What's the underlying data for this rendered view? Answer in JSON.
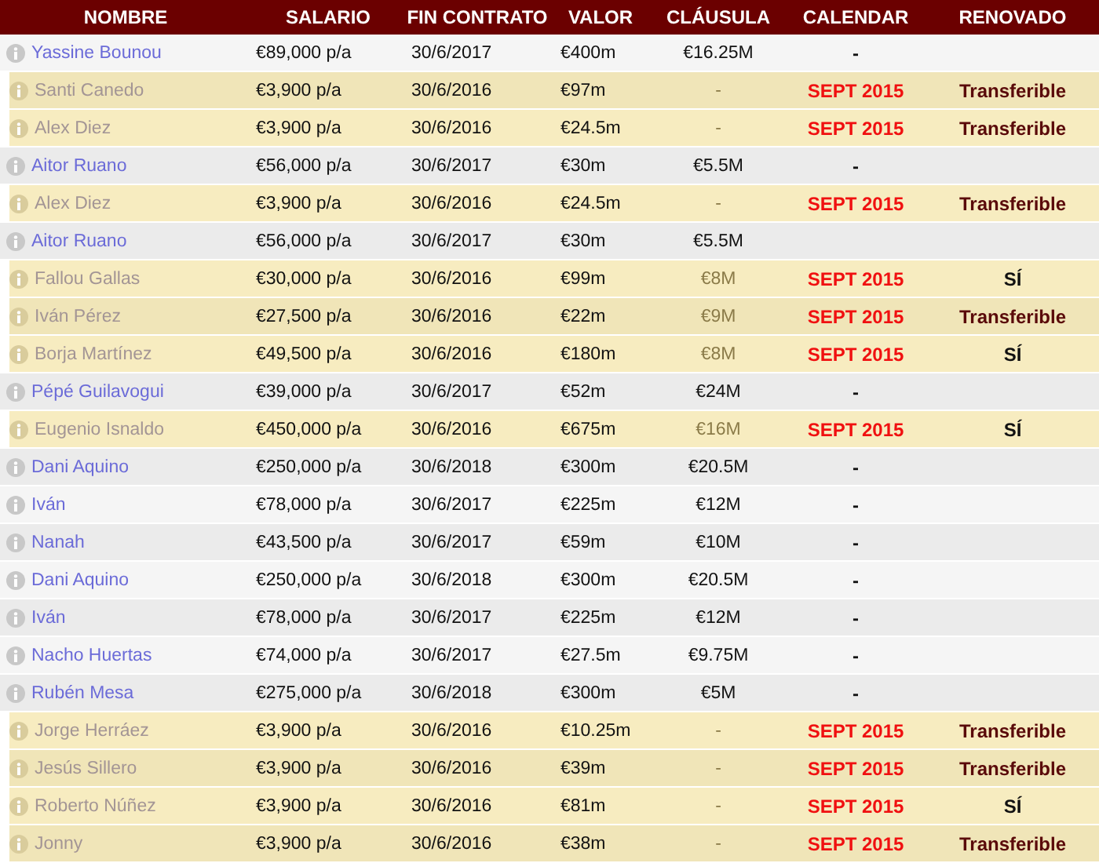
{
  "table": {
    "columns": [
      "NOMBRE",
      "SALARIO",
      "FIN CONTRATO",
      "VALOR",
      "CLÁUSULA",
      "CALENDAR",
      "RENOVADO"
    ],
    "rows": [
      {
        "highlighted": false,
        "name": "Yassine Bounou",
        "salary": "€89,000 p/a",
        "contract_end": "30/6/2017",
        "value": "€400m",
        "clause": "€16.25M",
        "calendar": {
          "text": "-",
          "kind": "plain"
        }
      },
      {
        "highlighted": true,
        "name": "Santi Canedo",
        "salary": "€3,900 p/a",
        "contract_end": "30/6/2016",
        "value": "€97m",
        "clause": "-",
        "calendar": {
          "text": "SEPT 2015",
          "kind": "date"
        },
        "renewed": {
          "text": "Transferible",
          "kind": "transfer"
        }
      },
      {
        "highlighted": true,
        "name": "Alex Diez",
        "salary": "€3,900 p/a",
        "contract_end": "30/6/2016",
        "value": "€24.5m",
        "clause": "-",
        "calendar": {
          "text": "SEPT 2015",
          "kind": "date"
        },
        "renewed": {
          "text": "Transferible",
          "kind": "transfer"
        }
      },
      {
        "highlighted": false,
        "name": "Aitor Ruano",
        "salary": "€56,000 p/a",
        "contract_end": "30/6/2017",
        "value": "€30m",
        "clause": "€5.5M",
        "calendar": {
          "text": "-",
          "kind": "plain"
        }
      },
      {
        "highlighted": true,
        "name": "Alex Diez",
        "salary": "€3,900 p/a",
        "contract_end": "30/6/2016",
        "value": "€24.5m",
        "clause": "-",
        "calendar": {
          "text": "SEPT 2015",
          "kind": "date"
        },
        "renewed": {
          "text": "Transferible",
          "kind": "transfer"
        }
      },
      {
        "highlighted": false,
        "name": "Aitor Ruano",
        "salary": "€56,000 p/a",
        "contract_end": "30/6/2017",
        "value": "€30m",
        "clause": "€5.5M"
      },
      {
        "highlighted": true,
        "name": "Fallou Gallas",
        "salary": "€30,000 p/a",
        "contract_end": "30/6/2016",
        "value": "€99m",
        "clause": "€8M",
        "calendar": {
          "text": "SEPT 2015",
          "kind": "date"
        },
        "renewed": {
          "text": "SÍ",
          "kind": "yes"
        }
      },
      {
        "highlighted": true,
        "name": "Iván Pérez",
        "salary": "€27,500 p/a",
        "contract_end": "30/6/2016",
        "value": "€22m",
        "clause": "€9M",
        "calendar": {
          "text": "SEPT 2015",
          "kind": "date"
        },
        "renewed": {
          "text": "Transferible",
          "kind": "transfer"
        }
      },
      {
        "highlighted": true,
        "name": "Borja Martínez",
        "salary": "€49,500 p/a",
        "contract_end": "30/6/2016",
        "value": "€180m",
        "clause": "€8M",
        "calendar": {
          "text": "SEPT 2015",
          "kind": "date"
        },
        "renewed": {
          "text": "SÍ",
          "kind": "yes"
        }
      },
      {
        "highlighted": false,
        "name": "Pépé Guilavogui",
        "salary": "€39,000 p/a",
        "contract_end": "30/6/2017",
        "value": "€52m",
        "clause": "€24M",
        "calendar": {
          "text": "-",
          "kind": "plain"
        }
      },
      {
        "highlighted": true,
        "name": "Eugenio Isnaldo",
        "salary": "€450,000 p/a",
        "contract_end": "30/6/2016",
        "value": "€675m",
        "clause": "€16M",
        "calendar": {
          "text": "SEPT 2015",
          "kind": "date"
        },
        "renewed": {
          "text": "SÍ",
          "kind": "yes"
        }
      },
      {
        "highlighted": false,
        "name": "Dani Aquino",
        "salary": "€250,000 p/a",
        "contract_end": "30/6/2018",
        "value": "€300m",
        "clause": "€20.5M",
        "calendar": {
          "text": "-",
          "kind": "plain"
        }
      },
      {
        "highlighted": false,
        "name": "Iván",
        "salary": "€78,000 p/a",
        "contract_end": "30/6/2017",
        "value": "€225m",
        "clause": "€12M",
        "calendar": {
          "text": "-",
          "kind": "plain"
        }
      },
      {
        "highlighted": false,
        "name": "Nanah",
        "salary": "€43,500 p/a",
        "contract_end": "30/6/2017",
        "value": "€59m",
        "clause": "€10M",
        "calendar": {
          "text": "-",
          "kind": "plain"
        }
      },
      {
        "highlighted": false,
        "name": "Dani Aquino",
        "salary": "€250,000 p/a",
        "contract_end": "30/6/2018",
        "value": "€300m",
        "clause": "€20.5M",
        "calendar": {
          "text": "-",
          "kind": "plain"
        }
      },
      {
        "highlighted": false,
        "name": "Iván",
        "salary": "€78,000 p/a",
        "contract_end": "30/6/2017",
        "value": "€225m",
        "clause": "€12M",
        "calendar": {
          "text": "-",
          "kind": "plain"
        }
      },
      {
        "highlighted": false,
        "name": "Nacho Huertas",
        "salary": "€74,000 p/a",
        "contract_end": "30/6/2017",
        "value": "€27.5m",
        "clause": "€9.75M",
        "calendar": {
          "text": "-",
          "kind": "plain"
        }
      },
      {
        "highlighted": false,
        "name": "Rubén Mesa",
        "salary": "€275,000 p/a",
        "contract_end": "30/6/2018",
        "value": "€300m",
        "clause": "€5M",
        "calendar": {
          "text": "-",
          "kind": "plain"
        }
      },
      {
        "highlighted": true,
        "name": "Jorge Herráez",
        "salary": "€3,900 p/a",
        "contract_end": "30/6/2016",
        "value": "€10.25m",
        "clause": "-",
        "calendar": {
          "text": "SEPT 2015",
          "kind": "date"
        },
        "renewed": {
          "text": "Transferible",
          "kind": "transfer"
        }
      },
      {
        "highlighted": true,
        "name": "Jesús Sillero",
        "salary": "€3,900 p/a",
        "contract_end": "30/6/2016",
        "value": "€39m",
        "clause": "-",
        "calendar": {
          "text": "SEPT 2015",
          "kind": "date"
        },
        "renewed": {
          "text": "Transferible",
          "kind": "transfer"
        }
      },
      {
        "highlighted": true,
        "name": "Roberto Núñez",
        "salary": "€3,900 p/a",
        "contract_end": "30/6/2016",
        "value": "€81m",
        "clause": "-",
        "calendar": {
          "text": "SEPT 2015",
          "kind": "date"
        },
        "renewed": {
          "text": "SÍ",
          "kind": "yes"
        }
      },
      {
        "highlighted": true,
        "name": "Jonny",
        "salary": "€3,900 p/a",
        "contract_end": "30/6/2016",
        "value": "€38m",
        "clause": "-",
        "calendar": {
          "text": "SEPT 2015",
          "kind": "date"
        },
        "renewed": {
          "text": "Transferible",
          "kind": "transfer"
        }
      }
    ]
  }
}
